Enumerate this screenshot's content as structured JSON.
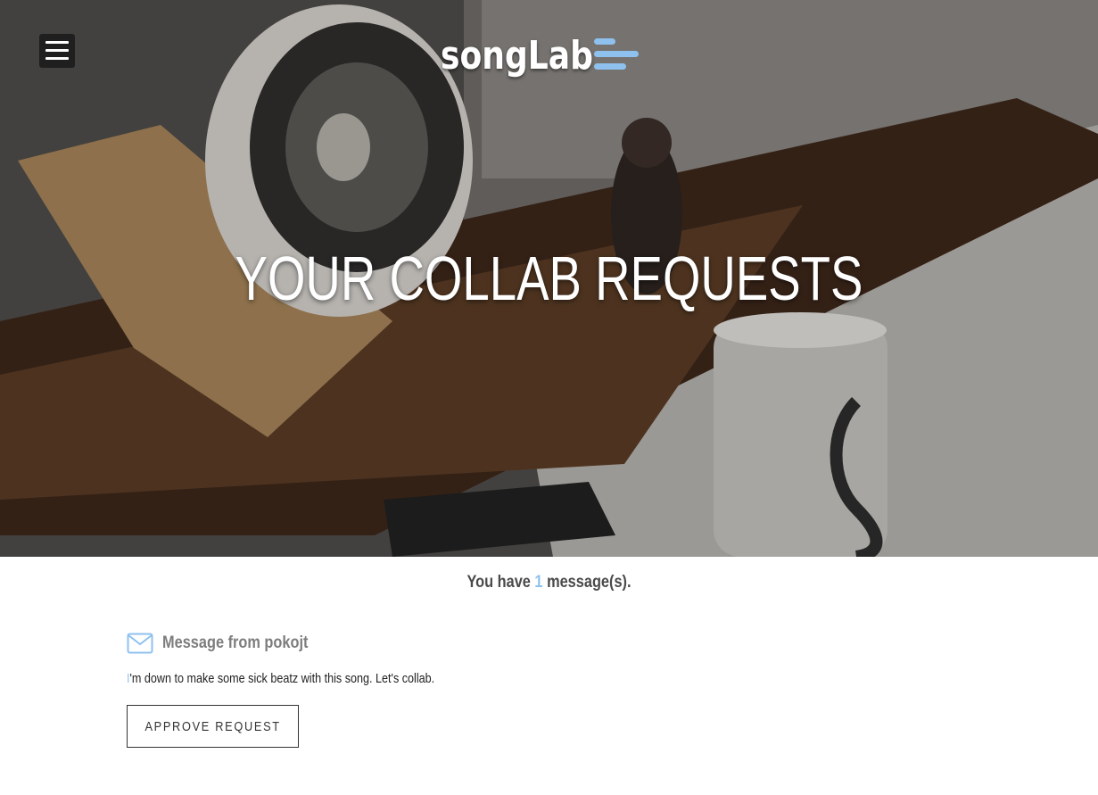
{
  "header": {
    "menu_icon": "hamburger-menu-icon",
    "logo_text": "songLab",
    "logo_icon": "equalizer-lines-icon",
    "logo_accent_color": "#8fc1ef"
  },
  "hero": {
    "title": "YOUR COLLAB REQUESTS",
    "background": "photo"
  },
  "summary": {
    "prefix": "You have",
    "count": "1",
    "suffix": "message(s)."
  },
  "messages": [
    {
      "icon": "envelope-icon",
      "title": "Message from pokojt",
      "body_first_char": "I",
      "body_rest": "'m down to make some sick beatz with this song. Let's collab.",
      "action_label": "APPROVE REQUEST"
    }
  ],
  "colors": {
    "accent": "#8fc1ef",
    "text_dark": "#4a4a4a",
    "text_muted": "#7d7d7d"
  }
}
